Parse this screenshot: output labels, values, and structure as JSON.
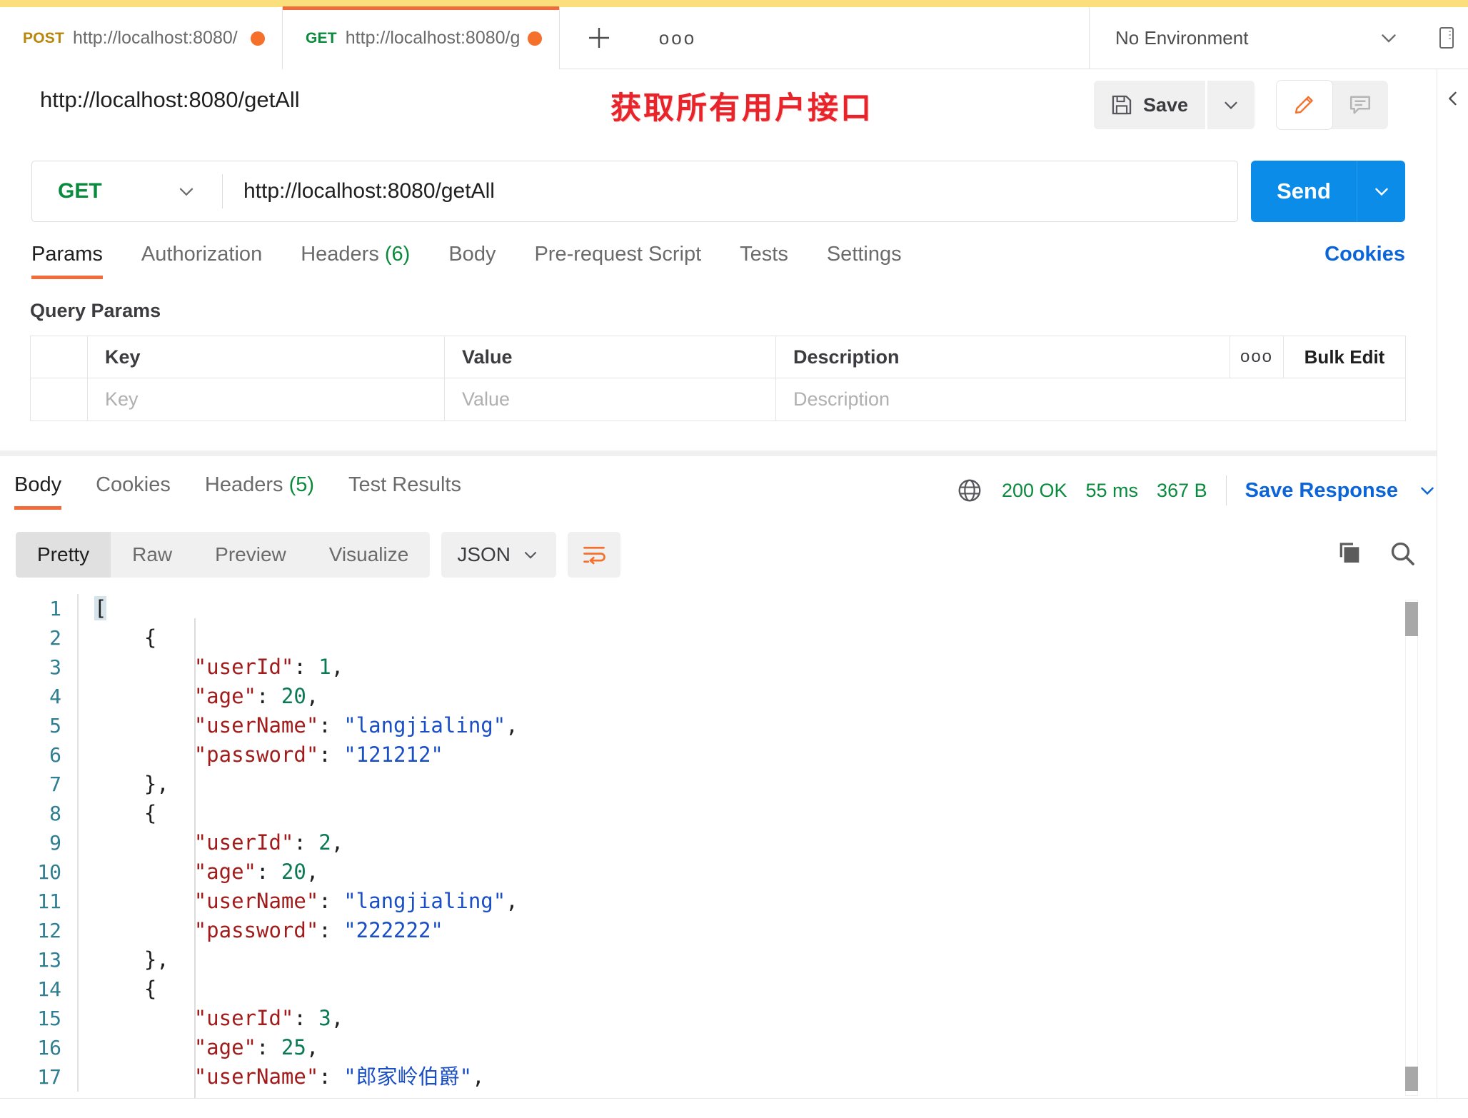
{
  "window": {
    "top_strip_color": "#fbdf7c",
    "accent_orange": "#f26b3a",
    "accent_blue": "#0c8ce9"
  },
  "tabbar": {
    "tabs": [
      {
        "method": "POST",
        "url": "http://localhost:8080/",
        "unsaved": true,
        "active": false
      },
      {
        "method": "GET",
        "url": "http://localhost:8080/g",
        "unsaved": true,
        "active": true
      }
    ],
    "new_tab_icon": "plus-icon",
    "more_icon": "ellipsis-icon",
    "environment": {
      "label": "No Environment",
      "caret": "chevron-down-icon"
    },
    "panel_icon": "side-panel-icon"
  },
  "request_header": {
    "title": "http://localhost:8080/getAll",
    "annotation": "获取所有用户接口",
    "annotation_color": "#e8232a",
    "save_label": "Save",
    "save_icon": "floppy-disk-icon",
    "save_caret": "chevron-down-icon",
    "edit_icon": "pencil-icon",
    "comment_icon": "comment-icon"
  },
  "url_bar": {
    "method": "GET",
    "method_caret": "chevron-down-icon",
    "url": "http://localhost:8080/getAll",
    "send_label": "Send",
    "send_caret": "chevron-down-icon"
  },
  "request_tabs": {
    "items": [
      {
        "label": "Params",
        "count": "",
        "active": true
      },
      {
        "label": "Authorization",
        "count": "",
        "active": false
      },
      {
        "label": "Headers",
        "count": "(6)",
        "active": false
      },
      {
        "label": "Body",
        "count": "",
        "active": false
      },
      {
        "label": "Pre-request Script",
        "count": "",
        "active": false
      },
      {
        "label": "Tests",
        "count": "",
        "active": false
      },
      {
        "label": "Settings",
        "count": "",
        "active": false
      }
    ],
    "cookies_link": "Cookies"
  },
  "query_params": {
    "section_title": "Query Params",
    "headers": {
      "key": "Key",
      "value": "Value",
      "description": "Description"
    },
    "more_icon": "ellipsis-icon",
    "bulk_edit": "Bulk Edit",
    "rows": [
      {
        "key_placeholder": "Key",
        "value_placeholder": "Value",
        "description_placeholder": "Description"
      }
    ]
  },
  "response": {
    "tabs": [
      {
        "label": "Body",
        "count": "",
        "active": true
      },
      {
        "label": "Cookies",
        "count": "",
        "active": false
      },
      {
        "label": "Headers",
        "count": "(5)",
        "active": false
      },
      {
        "label": "Test Results",
        "count": "",
        "active": false
      }
    ],
    "globe_icon": "globe-icon",
    "status": "200 OK",
    "time": "55 ms",
    "size": "367 B",
    "save_response": "Save Response",
    "save_response_caret": "chevron-down-icon",
    "view_modes": [
      {
        "label": "Pretty",
        "active": true
      },
      {
        "label": "Raw",
        "active": false
      },
      {
        "label": "Preview",
        "active": false
      },
      {
        "label": "Visualize",
        "active": false
      }
    ],
    "format": "JSON",
    "format_caret": "chevron-down-icon",
    "wrap_icon": "word-wrap-icon",
    "copy_icon": "copy-icon",
    "search_icon": "search-icon",
    "body_lines": [
      {
        "n": "1",
        "indent": 0,
        "tokens": [
          {
            "t": "[",
            "c": "p",
            "hl": true
          }
        ]
      },
      {
        "n": "2",
        "indent": 1,
        "tokens": [
          {
            "t": "{",
            "c": "p"
          }
        ]
      },
      {
        "n": "3",
        "indent": 2,
        "tokens": [
          {
            "t": "\"userId\"",
            "c": "k"
          },
          {
            "t": ": ",
            "c": "p"
          },
          {
            "t": "1",
            "c": "n"
          },
          {
            "t": ",",
            "c": "p"
          }
        ]
      },
      {
        "n": "4",
        "indent": 2,
        "tokens": [
          {
            "t": "\"age\"",
            "c": "k"
          },
          {
            "t": ": ",
            "c": "p"
          },
          {
            "t": "20",
            "c": "n"
          },
          {
            "t": ",",
            "c": "p"
          }
        ]
      },
      {
        "n": "5",
        "indent": 2,
        "tokens": [
          {
            "t": "\"userName\"",
            "c": "k"
          },
          {
            "t": ": ",
            "c": "p"
          },
          {
            "t": "\"langjialing\"",
            "c": "s"
          },
          {
            "t": ",",
            "c": "p"
          }
        ]
      },
      {
        "n": "6",
        "indent": 2,
        "tokens": [
          {
            "t": "\"password\"",
            "c": "k"
          },
          {
            "t": ": ",
            "c": "p"
          },
          {
            "t": "\"121212\"",
            "c": "s"
          }
        ]
      },
      {
        "n": "7",
        "indent": 1,
        "tokens": [
          {
            "t": "},",
            "c": "p"
          }
        ]
      },
      {
        "n": "8",
        "indent": 1,
        "tokens": [
          {
            "t": "{",
            "c": "p"
          }
        ]
      },
      {
        "n": "9",
        "indent": 2,
        "tokens": [
          {
            "t": "\"userId\"",
            "c": "k"
          },
          {
            "t": ": ",
            "c": "p"
          },
          {
            "t": "2",
            "c": "n"
          },
          {
            "t": ",",
            "c": "p"
          }
        ]
      },
      {
        "n": "10",
        "indent": 2,
        "tokens": [
          {
            "t": "\"age\"",
            "c": "k"
          },
          {
            "t": ": ",
            "c": "p"
          },
          {
            "t": "20",
            "c": "n"
          },
          {
            "t": ",",
            "c": "p"
          }
        ]
      },
      {
        "n": "11",
        "indent": 2,
        "tokens": [
          {
            "t": "\"userName\"",
            "c": "k"
          },
          {
            "t": ": ",
            "c": "p"
          },
          {
            "t": "\"langjialing\"",
            "c": "s"
          },
          {
            "t": ",",
            "c": "p"
          }
        ]
      },
      {
        "n": "12",
        "indent": 2,
        "tokens": [
          {
            "t": "\"password\"",
            "c": "k"
          },
          {
            "t": ": ",
            "c": "p"
          },
          {
            "t": "\"222222\"",
            "c": "s"
          }
        ]
      },
      {
        "n": "13",
        "indent": 1,
        "tokens": [
          {
            "t": "},",
            "c": "p"
          }
        ]
      },
      {
        "n": "14",
        "indent": 1,
        "tokens": [
          {
            "t": "{",
            "c": "p"
          }
        ]
      },
      {
        "n": "15",
        "indent": 2,
        "tokens": [
          {
            "t": "\"userId\"",
            "c": "k"
          },
          {
            "t": ": ",
            "c": "p"
          },
          {
            "t": "3",
            "c": "n"
          },
          {
            "t": ",",
            "c": "p"
          }
        ]
      },
      {
        "n": "16",
        "indent": 2,
        "tokens": [
          {
            "t": "\"age\"",
            "c": "k"
          },
          {
            "t": ": ",
            "c": "p"
          },
          {
            "t": "25",
            "c": "n"
          },
          {
            "t": ",",
            "c": "p"
          }
        ]
      },
      {
        "n": "17",
        "indent": 2,
        "tokens": [
          {
            "t": "\"userName\"",
            "c": "k"
          },
          {
            "t": ": ",
            "c": "p"
          },
          {
            "t": "\"郎家岭伯爵\"",
            "c": "s"
          },
          {
            "t": ",",
            "c": "p"
          }
        ]
      }
    ]
  }
}
